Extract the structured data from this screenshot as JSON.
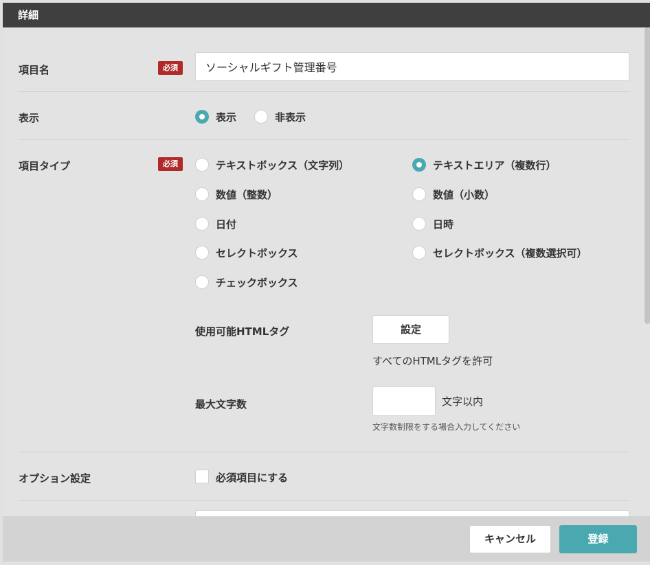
{
  "header": {
    "title": "詳細"
  },
  "fields": {
    "item_name": {
      "label": "項目名",
      "required_badge": "必須",
      "value": "ソーシャルギフト管理番号"
    },
    "display": {
      "label": "表示",
      "options": [
        {
          "label": "表示",
          "checked": true
        },
        {
          "label": "非表示",
          "checked": false
        }
      ]
    },
    "item_type": {
      "label": "項目タイプ",
      "required_badge": "必須",
      "options": [
        {
          "label": "テキストボックス（文字列）",
          "checked": false
        },
        {
          "label": "テキストエリア（複数行）",
          "checked": true
        },
        {
          "label": "数値（整数）",
          "checked": false
        },
        {
          "label": "数値（小数）",
          "checked": false
        },
        {
          "label": "日付",
          "checked": false
        },
        {
          "label": "日時",
          "checked": false
        },
        {
          "label": "セレクトボックス",
          "checked": false
        },
        {
          "label": "セレクトボックス（複数選択可）",
          "checked": false
        },
        {
          "label": "チェックボックス",
          "checked": false
        }
      ],
      "html_tags": {
        "label": "使用可能HTMLタグ",
        "button": "設定",
        "status": "すべてのHTMLタグを許可"
      },
      "max_chars": {
        "label": "最大文字数",
        "value": "",
        "suffix": "文字以内",
        "hint": "文字数制限をする場合入力してください"
      }
    },
    "options": {
      "label": "オプション設定",
      "checkbox_label": "必須項目にする",
      "checked": false
    }
  },
  "footer": {
    "cancel_label": "キャンセル",
    "submit_label": "登録"
  },
  "colors": {
    "accent": "#4aa8b0",
    "required": "#b02a2a",
    "header_bg": "#3f3f3f"
  }
}
